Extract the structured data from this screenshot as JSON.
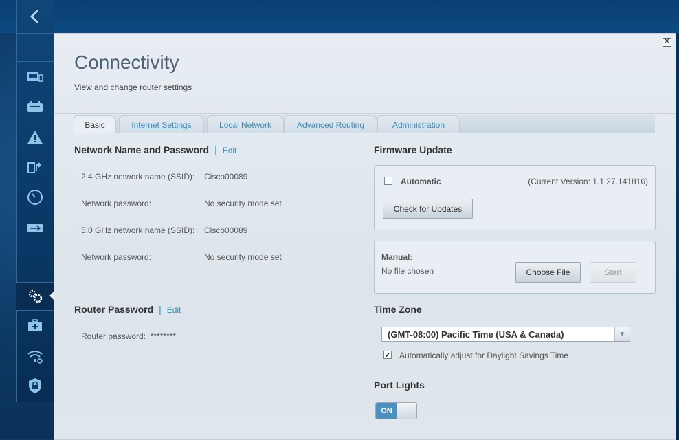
{
  "window": {
    "close_icon": "close-icon"
  },
  "page": {
    "title": "Connectivity",
    "subtitle": "View and change router settings"
  },
  "sidebar": {
    "back_icon": "chevron-left-icon",
    "items": [
      {
        "name": "devices",
        "icon": "devices-icon"
      },
      {
        "name": "router",
        "icon": "router-icon"
      },
      {
        "name": "troubleshooting",
        "icon": "warning-icon"
      },
      {
        "name": "media",
        "icon": "media-prioritization-icon"
      },
      {
        "name": "speed",
        "icon": "speedometer-icon"
      },
      {
        "name": "usb",
        "icon": "usb-icon"
      },
      {
        "name": "connectivity",
        "icon": "gear-icon",
        "active": true
      },
      {
        "name": "first-aid",
        "icon": "first-aid-icon"
      },
      {
        "name": "wireless",
        "icon": "wireless-icon"
      },
      {
        "name": "security",
        "icon": "shield-lock-icon"
      }
    ]
  },
  "tabs": [
    {
      "label": "Basic",
      "active": true
    },
    {
      "label": "Internet Settings",
      "active": false
    },
    {
      "label": "Local Network",
      "active": false
    },
    {
      "label": "Advanced Routing",
      "active": false
    },
    {
      "label": "Administration",
      "active": false
    }
  ],
  "network": {
    "title": "Network Name and Password",
    "separator": "|",
    "edit": "Edit",
    "rows": [
      {
        "label": "2.4 GHz network name (SSID):",
        "value": "Cisco00089"
      },
      {
        "label": "Network password:",
        "value": "No security mode set"
      },
      {
        "label": "5.0 GHz network name (SSID):",
        "value": "Cisco00089"
      },
      {
        "label": "Network password:",
        "value": "No security mode set"
      }
    ]
  },
  "router_password": {
    "title": "Router Password",
    "separator": "|",
    "edit": "Edit",
    "label": "Router password:",
    "value": "********"
  },
  "firmware": {
    "title": "Firmware Update",
    "automatic_label": "Automatic",
    "automatic_checked": false,
    "current_version": "(Current Version: 1.1.27.141816)",
    "check_button": "Check for Updates",
    "manual_label": "Manual:",
    "file_status": "No file chosen",
    "choose_button": "Choose File",
    "start_button": "Start"
  },
  "timezone": {
    "title": "Time Zone",
    "selected": "(GMT-08:00) Pacific Time (USA & Canada)",
    "dst_label": "Automatically adjust for Daylight Savings Time",
    "dst_checked": true
  },
  "port_lights": {
    "title": "Port Lights",
    "state": "ON"
  },
  "colors": {
    "accent": "#3a8dbb",
    "toggle_on": "#4a90c0"
  }
}
